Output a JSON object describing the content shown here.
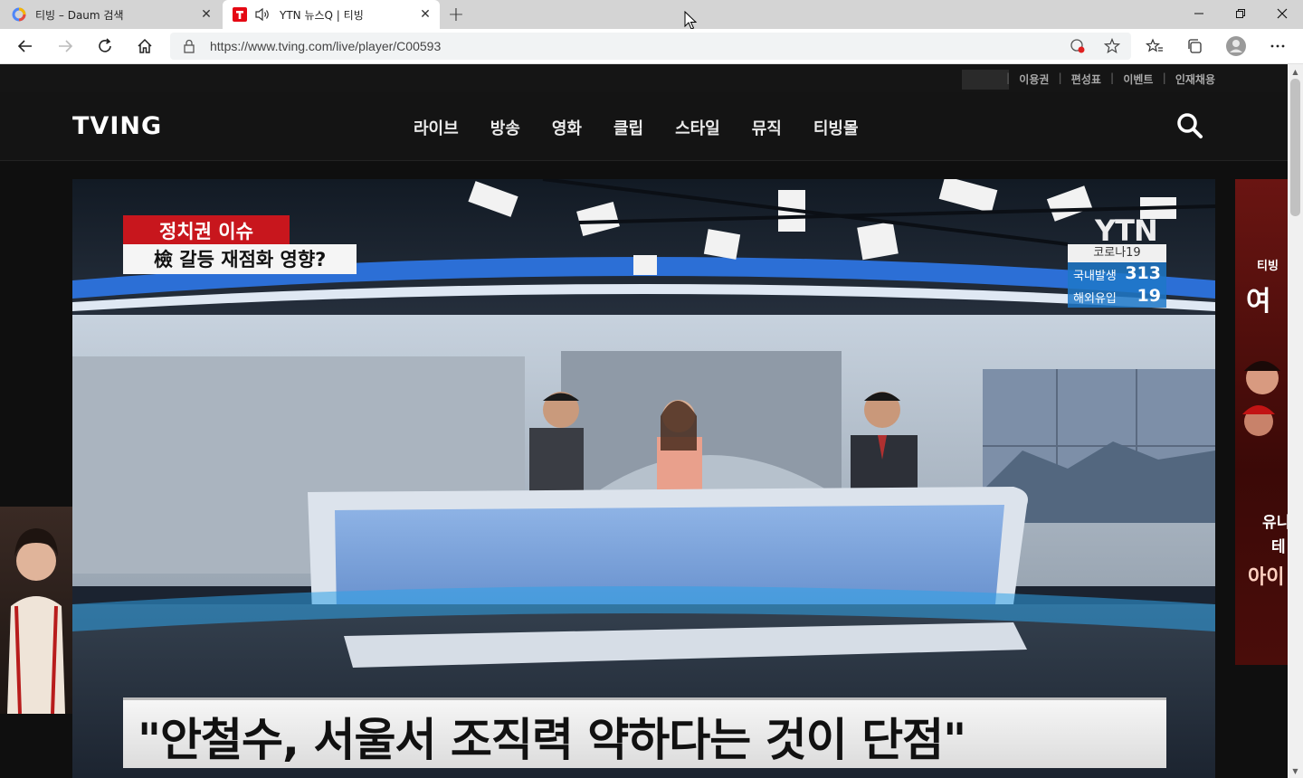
{
  "browser": {
    "tabs": [
      {
        "title": "티빙 – Daum 검색",
        "active": false,
        "favicon_color": "#4f86f7"
      },
      {
        "title": "YTN 뉴스Q | 티빙",
        "active": true,
        "favicon_color": "#e50914",
        "audio": true
      }
    ],
    "url": "https://www.tving.com/live/player/C00593",
    "window_controls": {
      "minimize": "—",
      "maximize": "❐",
      "close": "✕"
    }
  },
  "utility_links": [
    "이용권",
    "편성표",
    "이벤트",
    "인재채용"
  ],
  "header": {
    "logo": "TVING",
    "nav": [
      "라이브",
      "방송",
      "영화",
      "클립",
      "스타일",
      "뮤직",
      "티빙몰"
    ]
  },
  "video": {
    "issue_tag": "정치권 이슈",
    "issue_sub": "檢 갈등 재점화 영향?",
    "channel_logo": "YTN",
    "covid": {
      "title": "코로나19",
      "domestic_label": "국내발생",
      "domestic_value": "313",
      "overseas_label": "해외유입",
      "overseas_value": "19"
    },
    "headline": "\"안철수, 서울서 조직력 약하다는 것이 단점\""
  },
  "right_ad": {
    "line1": "티빙 ",
    "line2": "여",
    "line3": "유니",
    "line4": "테",
    "line5": "아이"
  },
  "colors": {
    "brand": "#ffffff",
    "tving_red": "#e50914",
    "issue_red": "#c8161d",
    "covid_blue": "#1e78c8"
  }
}
